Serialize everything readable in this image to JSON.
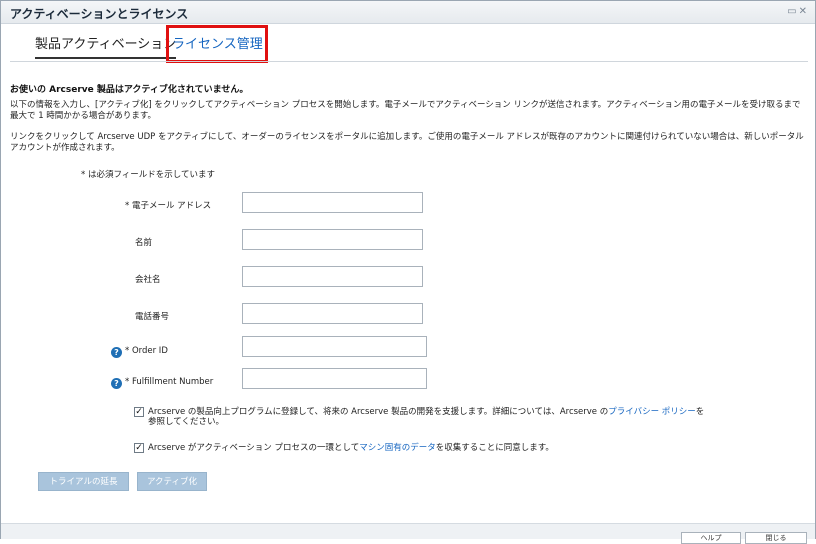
{
  "window": {
    "title": "アクティベーションとライセンス",
    "icons": [
      "restore-icon",
      "close-icon"
    ]
  },
  "tabs": [
    {
      "label": "製品アクティベーション",
      "active": true
    },
    {
      "label": "ライセンス管理",
      "active": false
    }
  ],
  "colors": {
    "accent": "#1565c0",
    "highlight_box": "#e01010",
    "help_icon": "#1f6fb5",
    "disabled_button": "#a9c4dc"
  },
  "messages": {
    "warning": "お使いの Arcserve 製品はアクティブ化されていません。",
    "para1": "以下の情報を入力し、[アクティブ化] をクリックしてアクティベーション プロセスを開始します。電子メールでアクティベーション リンクが送信されます。アクティベーション用の電子メールを受け取るまで最大で 1 時間かかる場合があります。",
    "para2": "リンクをクリックして Arcserve UDP をアクティブにして、オーダーのライセンスをポータルに追加します。ご使用の電子メール アドレスが既存のアカウントに関連付けられていない場合は、新しいポータル アカウントが作成されます。",
    "required_note": "* は必須フィールドを示しています"
  },
  "form": {
    "email": {
      "label": "* 電子メール アドレス",
      "value": ""
    },
    "name": {
      "label": "名前",
      "value": ""
    },
    "company": {
      "label": "会社名",
      "value": ""
    },
    "phone": {
      "label": "電話番号",
      "value": ""
    },
    "order_id": {
      "label": "* Order ID",
      "value": ""
    },
    "fulfillment": {
      "label": "* Fulfillment Number",
      "value": ""
    }
  },
  "consent": {
    "improvement": {
      "checked": true,
      "text_before": "Arcserve の製品向上プログラムに登録して、将来の Arcserve 製品の開発を支援します。詳細については、Arcserve の",
      "link": "プライバシー ポリシー",
      "text_after": "を参照してください。"
    },
    "machine_data": {
      "checked": true,
      "text_before": "Arcserve がアクティベーション プロセスの一環として",
      "link": "マシン固有のデータ",
      "text_after": "を収集することに同意します。"
    }
  },
  "buttons": {
    "extend_trial": "トライアルの延長",
    "activate": "アクティブ化"
  },
  "footer": {
    "help": "ヘルプ",
    "close": "閉じる"
  }
}
